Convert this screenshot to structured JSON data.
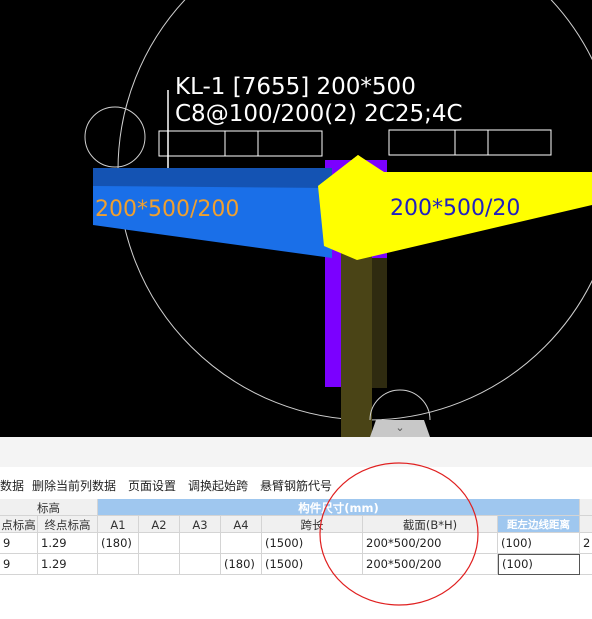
{
  "canvas": {
    "beam_label_line1": "KL-1 [7655] 200*500",
    "beam_label_line2": "C8@100/200(2) 2C25;4C",
    "left_section_label": "200*500/200",
    "right_section_label": "200*500/20",
    "colors": {
      "background": "#000000",
      "left_beam": "#1a6fe8",
      "right_beam": "#ffff00",
      "column": "#7b00ff",
      "column_lower": "#4a4416",
      "left_label": "#f0a030",
      "right_label": "#2020c0",
      "lines": "#ffffff",
      "circle": "#d0d0d0"
    }
  },
  "toolbar": {
    "items": [
      "数据",
      "删除当前列数据",
      "页面设置",
      "调换起始跨",
      "悬臂钢筋代号"
    ]
  },
  "grid": {
    "group_headers": {
      "elevation": "标高",
      "member_size": "构件尺寸(mm)"
    },
    "columns": [
      "点标高",
      "终点标高",
      "A1",
      "A2",
      "A3",
      "A4",
      "跨长",
      "截面(B*H)",
      "距左边线距离"
    ],
    "rows": [
      [
        "9",
        "1.29",
        "(180)",
        "",
        "",
        "",
        "(1500)",
        "200*500/200",
        "(100)",
        "2"
      ],
      [
        "9",
        "1.29",
        "",
        "",
        "",
        "(180)",
        "(1500)",
        "200*500/200",
        "(100)",
        ""
      ]
    ]
  }
}
